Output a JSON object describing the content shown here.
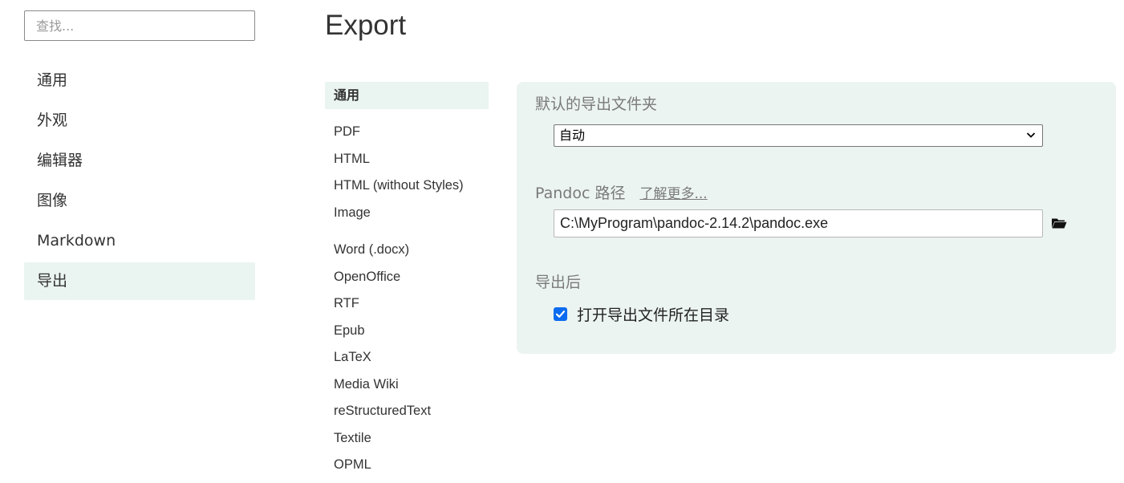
{
  "sidebar": {
    "search_placeholder": "查找...",
    "items": [
      {
        "label": "通用"
      },
      {
        "label": "外观"
      },
      {
        "label": "编辑器"
      },
      {
        "label": "图像"
      },
      {
        "label": "Markdown"
      },
      {
        "label": "导出",
        "active": true
      }
    ]
  },
  "page": {
    "title": "Export"
  },
  "subnav": {
    "items": [
      {
        "label": "通用",
        "active": true
      },
      {
        "label": "PDF"
      },
      {
        "label": "HTML"
      },
      {
        "label": "HTML (without Styles)"
      },
      {
        "label": "Image"
      },
      {
        "label": "Word (.docx)"
      },
      {
        "label": "OpenOffice"
      },
      {
        "label": "RTF"
      },
      {
        "label": "Epub"
      },
      {
        "label": "LaTeX"
      },
      {
        "label": "Media Wiki"
      },
      {
        "label": "reStructuredText"
      },
      {
        "label": "Textile"
      },
      {
        "label": "OPML"
      }
    ]
  },
  "panel": {
    "default_folder_label": "默认的导出文件夹",
    "default_folder_value": "自动",
    "pandoc_label": "Pandoc 路径",
    "learn_more": "了解更多...",
    "pandoc_path": "C:\\MyProgram\\pandoc-2.14.2\\pandoc.exe",
    "after_export_label": "导出后",
    "open_folder_checkbox_label": "打开导出文件所在目录",
    "open_folder_checked": true
  },
  "colors": {
    "active_bg": "#eaf4f1",
    "panel_bg": "#ebf4f1",
    "checkbox": "#0b6cf0"
  },
  "icons": [
    "chevron-down-icon",
    "folder-icon",
    "checkmark-icon"
  ]
}
